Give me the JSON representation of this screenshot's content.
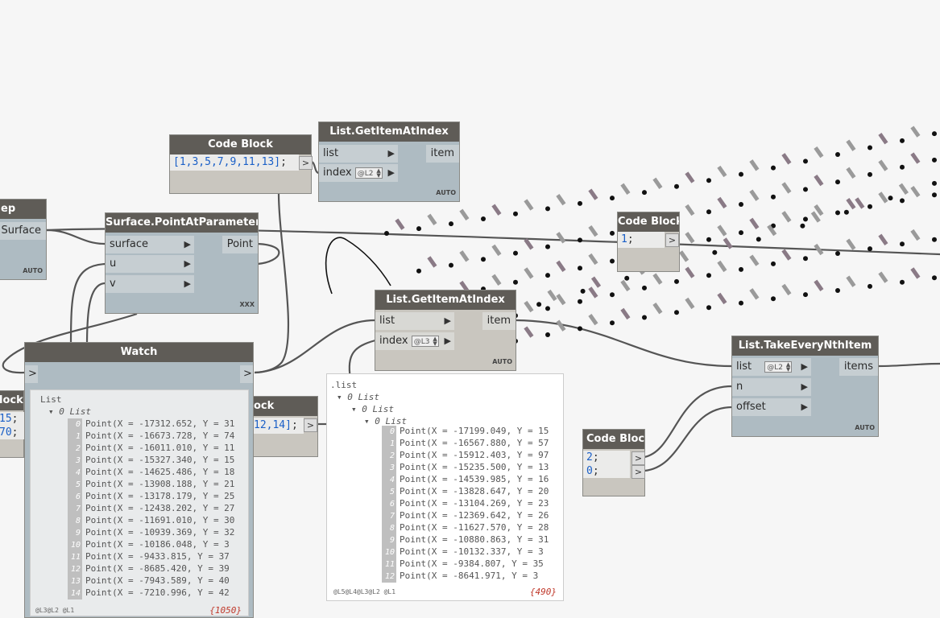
{
  "nodes": {
    "code1": {
      "title": "Code Block",
      "code": "[1,3,5,7,9,11,13]",
      "semi": ";"
    },
    "gia1": {
      "title": "List.GetItemAtIndex",
      "in_list": "list",
      "in_index": "index",
      "index_val": "@L2",
      "out": "item",
      "lacing": "AUTO"
    },
    "left_partial": {
      "title": "ep",
      "out": "Surface",
      "lacing": "AUTO"
    },
    "pap": {
      "title": "Surface.PointAtParameter",
      "in_surface": "surface",
      "in_u": "u",
      "in_v": "v",
      "out": "Point",
      "lacing": "XXX"
    },
    "code2": {
      "title": "Code Block",
      "code": "1",
      "semi": ";"
    },
    "gia2": {
      "title": "List.GetItemAtIndex",
      "in_list": "list",
      "in_index": "index",
      "index_val": "@L3",
      "out": "item",
      "lacing": "AUTO"
    },
    "take": {
      "title": "List.TakeEveryNthItem",
      "in_list": "list",
      "list_val": "@L2",
      "in_n": "n",
      "in_offset": "offset",
      "out": "items",
      "lacing": "AUTO"
    },
    "code3": {
      "title": "Code Block",
      "line1": "2",
      "line2": "0",
      "semi": ";"
    },
    "watch": {
      "title": "Watch",
      "in": ">",
      "out": ">"
    },
    "code_left": {
      "title": "lock",
      "line1": "15",
      "line2": "70",
      "semi": ";"
    },
    "code_mid": {
      "title": "ock",
      "code": "12,14]",
      "semi": ";"
    }
  },
  "watch_tree": {
    "root": "List",
    "sub": "0 List",
    "items": [
      {
        "i": "0",
        "t": "Point(X = -17312.652, Y = 31"
      },
      {
        "i": "1",
        "t": "Point(X = -16673.728, Y = 74"
      },
      {
        "i": "2",
        "t": "Point(X = -16011.010, Y = 11"
      },
      {
        "i": "3",
        "t": "Point(X = -15327.340, Y = 15"
      },
      {
        "i": "4",
        "t": "Point(X = -14625.486, Y = 18"
      },
      {
        "i": "5",
        "t": "Point(X = -13908.188, Y = 21"
      },
      {
        "i": "6",
        "t": "Point(X = -13178.179, Y = 25"
      },
      {
        "i": "7",
        "t": "Point(X = -12438.202, Y = 27"
      },
      {
        "i": "8",
        "t": "Point(X = -11691.010, Y = 30"
      },
      {
        "i": "9",
        "t": "Point(X = -10939.369, Y = 32"
      },
      {
        "i": "10",
        "t": "Point(X = -10186.048, Y = 3"
      },
      {
        "i": "11",
        "t": "Point(X = -9433.815, Y = 37"
      },
      {
        "i": "12",
        "t": "Point(X = -8685.420, Y = 39"
      },
      {
        "i": "13",
        "t": "Point(X = -7943.589, Y = 40"
      },
      {
        "i": "14",
        "t": "Point(X = -7210.996, Y = 42"
      }
    ],
    "levels": "@L3@L2 @L1",
    "count": "{1050}"
  },
  "preview_tree": {
    "root": ".list",
    "l1": "0 List",
    "l2": "0 List",
    "l3": "0 List",
    "items": [
      {
        "i": "0",
        "t": "Point(X = -17199.049, Y = 15"
      },
      {
        "i": "1",
        "t": "Point(X = -16567.880, Y = 57"
      },
      {
        "i": "2",
        "t": "Point(X = -15912.403, Y = 97"
      },
      {
        "i": "3",
        "t": "Point(X = -15235.500, Y = 13"
      },
      {
        "i": "4",
        "t": "Point(X = -14539.985, Y = 16"
      },
      {
        "i": "5",
        "t": "Point(X = -13828.647, Y = 20"
      },
      {
        "i": "6",
        "t": "Point(X = -13104.269, Y = 23"
      },
      {
        "i": "7",
        "t": "Point(X = -12369.642, Y = 26"
      },
      {
        "i": "8",
        "t": "Point(X = -11627.570, Y = 28"
      },
      {
        "i": "9",
        "t": "Point(X = -10880.863, Y = 31"
      },
      {
        "i": "10",
        "t": "Point(X = -10132.337, Y = 3"
      },
      {
        "i": "11",
        "t": "Point(X = -9384.807, Y = 35"
      },
      {
        "i": "12",
        "t": "Point(X = -8641.971, Y = 3"
      }
    ],
    "levels": "@L5@L4@L3@L2 @L1",
    "count": "{490}"
  }
}
